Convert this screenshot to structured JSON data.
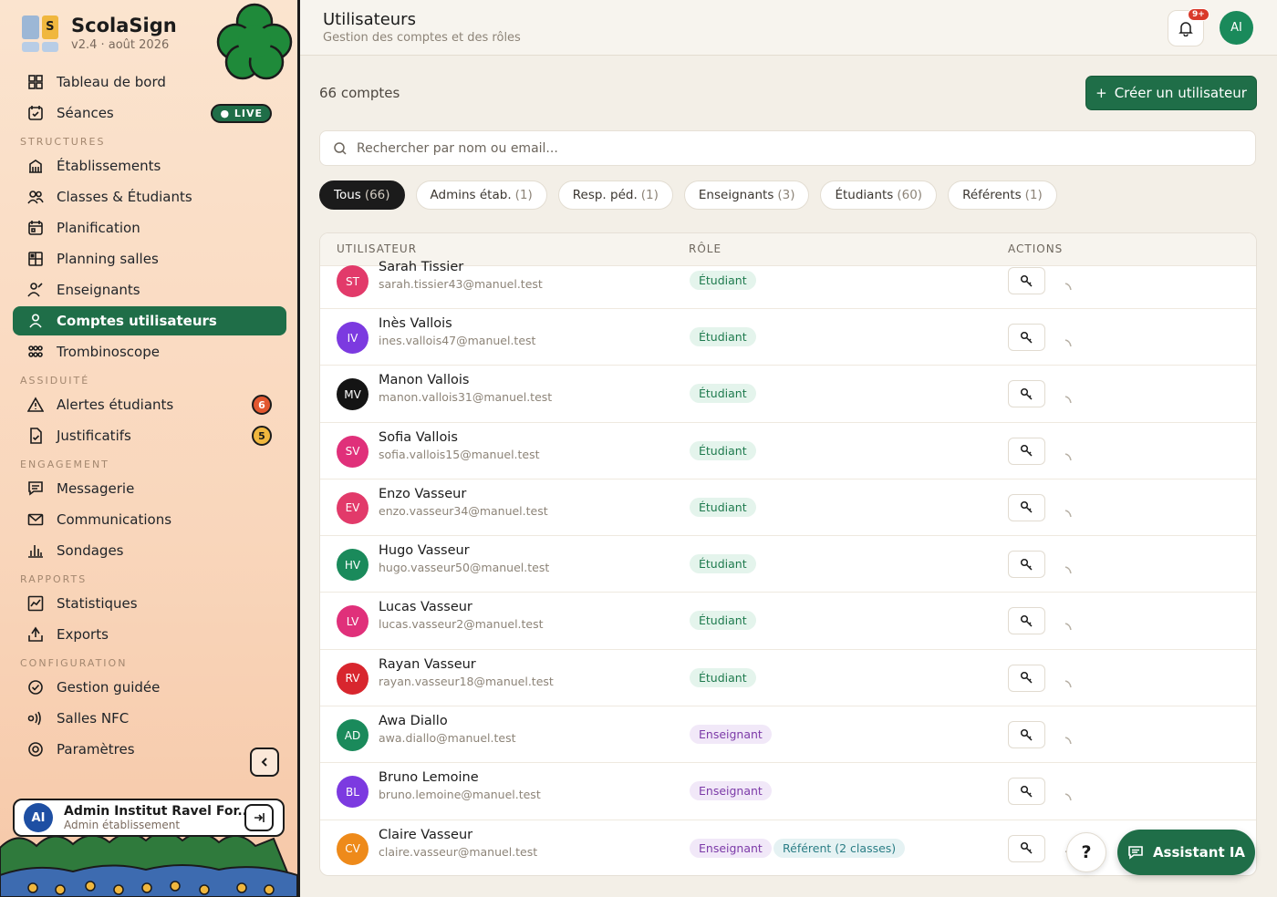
{
  "brand": {
    "name": "ScolaSign",
    "version": "v2.4 · août 2026",
    "logo_letter": "S"
  },
  "nav": {
    "top": [
      {
        "label": "Tableau de bord",
        "icon": "dashboard-icon"
      },
      {
        "label": "Séances",
        "icon": "calendar-check-icon",
        "badge": "LIVE"
      }
    ],
    "sections": [
      {
        "label": "STRUCTURES",
        "items": [
          {
            "label": "Établissements",
            "icon": "building-icon"
          },
          {
            "label": "Classes & Étudiants",
            "icon": "users-icon"
          },
          {
            "label": "Planification",
            "icon": "calendar-icon"
          },
          {
            "label": "Planning salles",
            "icon": "grid-icon"
          },
          {
            "label": "Enseignants",
            "icon": "teacher-icon"
          },
          {
            "label": "Comptes utilisateurs",
            "icon": "user-icon",
            "active": true
          },
          {
            "label": "Trombinoscope",
            "icon": "faces-icon"
          }
        ]
      },
      {
        "label": "ASSIDUITÉ",
        "items": [
          {
            "label": "Alertes étudiants",
            "icon": "alert-icon",
            "count": "6",
            "count_color": "#e2572f"
          },
          {
            "label": "Justificatifs",
            "icon": "document-check-icon",
            "count": "5",
            "count_color": "#f0b73e"
          }
        ]
      },
      {
        "label": "ENGAGEMENT",
        "items": [
          {
            "label": "Messagerie",
            "icon": "message-icon"
          },
          {
            "label": "Communications",
            "icon": "mail-icon"
          },
          {
            "label": "Sondages",
            "icon": "bar-chart-icon"
          }
        ]
      },
      {
        "label": "RAPPORTS",
        "items": [
          {
            "label": "Statistiques",
            "icon": "stats-icon"
          },
          {
            "label": "Exports",
            "icon": "export-icon"
          }
        ]
      },
      {
        "label": "CONFIGURATION",
        "items": [
          {
            "label": "Gestion guidée",
            "icon": "check-circle-icon"
          },
          {
            "label": "Salles NFC",
            "icon": "nfc-icon"
          },
          {
            "label": "Paramètres",
            "icon": "settings-icon"
          }
        ]
      }
    ]
  },
  "user_card": {
    "initials": "AI",
    "name": "Admin Institut Ravel For...",
    "role": "Admin établissement"
  },
  "header": {
    "title": "Utilisateurs",
    "subtitle": "Gestion des comptes et des rôles",
    "notif_badge": "9+",
    "avatar_initials": "AI"
  },
  "toolbar": {
    "count_label": "66 comptes",
    "create_label": "Créer un utilisateur",
    "create_prefix": "+"
  },
  "search": {
    "placeholder": "Rechercher par nom ou email..."
  },
  "filters": [
    {
      "label": "Tous",
      "count": "(66)",
      "active": true
    },
    {
      "label": "Admins étab.",
      "count": "(1)"
    },
    {
      "label": "Resp. péd.",
      "count": "(1)"
    },
    {
      "label": "Enseignants",
      "count": "(3)"
    },
    {
      "label": "Étudiants",
      "count": "(60)"
    },
    {
      "label": "Référents",
      "count": "(1)"
    }
  ],
  "table": {
    "headers": {
      "user": "UTILISATEUR",
      "role": "RÔLE",
      "actions": "ACTIONS"
    },
    "rows": [
      {
        "initials": "ST",
        "name": "Sarah Tissier",
        "email": "sarah.tissier43@manuel.test",
        "roles": [
          "Étudiant"
        ],
        "color": "#e23a6a"
      },
      {
        "initials": "IV",
        "name": "Inès Vallois",
        "email": "ines.vallois47@manuel.test",
        "roles": [
          "Étudiant"
        ],
        "color": "#7c3ae0"
      },
      {
        "initials": "MV",
        "name": "Manon Vallois",
        "email": "manon.vallois31@manuel.test",
        "roles": [
          "Étudiant"
        ],
        "color": "#141414"
      },
      {
        "initials": "SV",
        "name": "Sofia Vallois",
        "email": "sofia.vallois15@manuel.test",
        "roles": [
          "Étudiant"
        ],
        "color": "#e0307a"
      },
      {
        "initials": "EV",
        "name": "Enzo Vasseur",
        "email": "enzo.vasseur34@manuel.test",
        "roles": [
          "Étudiant"
        ],
        "color": "#e23a6a"
      },
      {
        "initials": "HV",
        "name": "Hugo Vasseur",
        "email": "hugo.vasseur50@manuel.test",
        "roles": [
          "Étudiant"
        ],
        "color": "#1a8a5b"
      },
      {
        "initials": "LV",
        "name": "Lucas Vasseur",
        "email": "lucas.vasseur2@manuel.test",
        "roles": [
          "Étudiant"
        ],
        "color": "#e0307a"
      },
      {
        "initials": "RV",
        "name": "Rayan Vasseur",
        "email": "rayan.vasseur18@manuel.test",
        "roles": [
          "Étudiant"
        ],
        "color": "#d8262e"
      },
      {
        "initials": "AD",
        "name": "Awa Diallo",
        "email": "awa.diallo@manuel.test",
        "roles": [
          "Enseignant"
        ],
        "color": "#1a8a5b"
      },
      {
        "initials": "BL",
        "name": "Bruno Lemoine",
        "email": "bruno.lemoine@manuel.test",
        "roles": [
          "Enseignant"
        ],
        "color": "#7c3ae0"
      },
      {
        "initials": "CV",
        "name": "Claire Vasseur",
        "email": "claire.vasseur@manuel.test",
        "roles": [
          "Enseignant",
          "Référent (2 classes)"
        ],
        "color": "#ee8a1a"
      }
    ]
  },
  "fab": {
    "help_label": "?",
    "assistant_label": "Assistant IA"
  }
}
